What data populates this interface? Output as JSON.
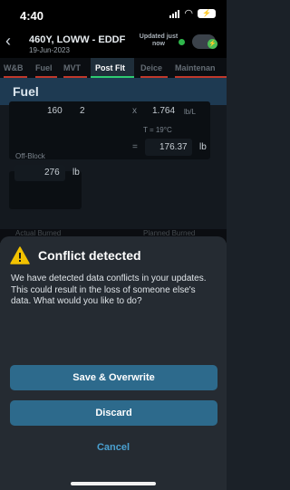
{
  "status_bar": {
    "time": "4:40",
    "wifi_icon": "wifi-icon",
    "battery_icon": "battery-charging-icon"
  },
  "header": {
    "back_icon": "chevron-left-icon",
    "flight_title": "460Y, LOWW - EDDF",
    "flight_date": "19-Jun-2023",
    "updated_label": "Updated just now",
    "sync_icon": "cloud-sync-icon"
  },
  "tabs": [
    {
      "label": "W&B",
      "color": "#c0392b"
    },
    {
      "label": "Fuel",
      "color": "#c0392b"
    },
    {
      "label": "MVT",
      "color": "#c0392b"
    },
    {
      "label": "Post Flt",
      "color": "#2ecc71"
    },
    {
      "label": "Deice",
      "color": "#c0392b"
    },
    {
      "label": "Maintenan",
      "color": "#c0392b"
    }
  ],
  "section": {
    "title": "Fuel"
  },
  "fuel": {
    "partial_a": "160",
    "partial_b": "2",
    "multiply_sign": "x",
    "density": "1.764",
    "density_unit": "lb/L",
    "temp": "T = 19°C",
    "equals_sign": "=",
    "result": "176.37",
    "result_unit": "lb",
    "offblock_label": "Off-Block",
    "offblock_value": "276",
    "offblock_unit": "lb",
    "actual_burned_label": "Actual Burned",
    "planned_burned_label": "Planned Burned"
  },
  "dialog": {
    "icon": "warning-icon",
    "title": "Conflict detected",
    "message": "We have detected data conflicts in your updates. This could result in the loss of someone else's data. What would you like to do?",
    "save_label": "Save & Overwrite",
    "discard_label": "Discard",
    "cancel_label": "Cancel"
  },
  "colors": {
    "accent": "#2d6a8c",
    "link": "#4aa0d0",
    "warning": "#f2c200",
    "sheet_bg": "#252b32"
  }
}
